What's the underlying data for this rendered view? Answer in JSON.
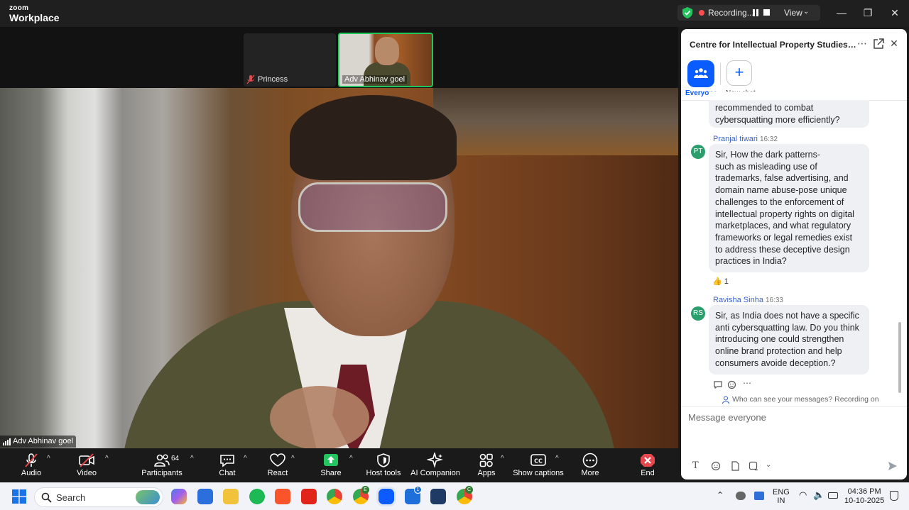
{
  "app": {
    "brand_top": "zoom",
    "brand_bottom": "Workplace",
    "recording_label": "Recording...",
    "view_label": "View",
    "view_caret": "⌄",
    "window_controls": {
      "minimize": "—",
      "maximize": "❐",
      "close": "✕"
    }
  },
  "participants_strip": [
    {
      "name": "Princess",
      "muted": true
    },
    {
      "name": "Adv Abhinav goel",
      "active_speaker": true
    }
  ],
  "main_video": {
    "name": "Adv Abhinav goel"
  },
  "toolbar": {
    "audio": "Audio",
    "video": "Video",
    "participants": "Participants",
    "participants_count": "64",
    "chat": "Chat",
    "react": "React",
    "share": "Share",
    "host_tools": "Host tools",
    "ai_companion": "AI Companion",
    "apps": "Apps",
    "captions": "Show captions",
    "more": "More",
    "end": "End",
    "caret": "^",
    "accent_share": "#22c55e",
    "accent_end": "#e5484d"
  },
  "chat": {
    "title": "Centre for Intellectual Property Studies (CIP...",
    "tabs": [
      {
        "label": "Everyone",
        "active": true
      },
      {
        "label": "New chat"
      }
    ],
    "messages": [
      {
        "lines": [
          "recommended to combat",
          "cybersquatting more efficiently?"
        ]
      },
      {
        "initials": "PT",
        "sender": "Pranjal tiwari",
        "time": "16:32",
        "lines": [
          "Sir, How the dark patterns-",
          "such as misleading use of",
          "trademarks, false advertising, and",
          "domain name abuse-pose unique",
          "challenges to the enforcement of",
          "intellectual property rights on digital",
          "marketplaces, and what regulatory",
          "frameworks or legal remedies exist",
          "to address these deceptive design",
          "practices in India?"
        ],
        "reaction": {
          "emoji": "👍",
          "count": "1"
        }
      },
      {
        "initials": "RS",
        "sender": "Ravisha Sinha",
        "time": "16:33",
        "lines": [
          "Sir, as India does not have a specific",
          "anti cybersquatting law. Do you think",
          "introducing one could strengthen",
          "online brand protection and help",
          "consumers avoide deception.?"
        ]
      }
    ],
    "privacy_note": "Who can see your messages? Recording on",
    "composer_placeholder": "Message everyone",
    "message_actions": "⋯"
  },
  "taskbar": {
    "search_label": "Search",
    "language_line1": "ENG",
    "language_line2": "IN",
    "clock_time": "04:36 PM",
    "clock_date": "10-10-2025",
    "chrome_badge_1": "E",
    "chrome_badge_2": "C",
    "teams_badge": "1"
  }
}
